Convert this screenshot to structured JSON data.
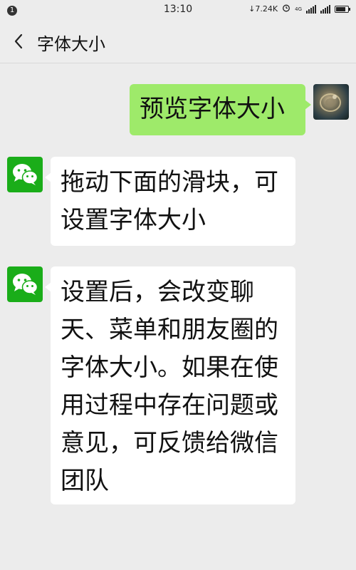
{
  "status_bar": {
    "notification_count": "1",
    "time": "13:10",
    "net_speed": "↓7.24K",
    "alarm_icon": "alarm-icon",
    "signal_label": "4G",
    "battery_level": 0.85
  },
  "nav": {
    "back_icon": "chevron-left-icon",
    "title": "字体大小"
  },
  "messages": [
    {
      "direction": "outgoing",
      "lines": [
        "预览字体大小"
      ]
    },
    {
      "direction": "incoming",
      "lines": [
        "拖动下面的滑块，可",
        "设置字体大小"
      ]
    },
    {
      "direction": "incoming",
      "lines": [
        "设置后，会改变聊",
        "天、菜单和朋友圈的",
        "字体大小。如果在使",
        "用过程中存在问题或",
        "意见，可反馈给微信",
        "团队"
      ]
    }
  ],
  "colors": {
    "outgoing_bubble": "#9eea6a",
    "incoming_bubble": "#ffffff",
    "wechat_green": "#1aad19",
    "background": "#ececec"
  }
}
